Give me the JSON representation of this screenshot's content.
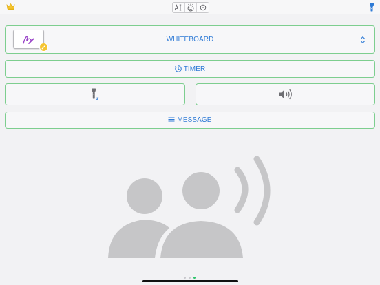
{
  "toolbar": {
    "left_icon": "crown-icon",
    "center_tools": [
      "text-cursor-icon",
      "face-icon",
      "zoom-out-icon"
    ],
    "right_icon": "torch-icon"
  },
  "controls": {
    "whiteboard": {
      "label": "WHITEBOARD",
      "thumbnail_icon": "pen-squiggle-icon",
      "badge_icon": "edit-icon"
    },
    "timer": {
      "label": "TIMER",
      "icon": "timer-icon"
    },
    "torch": {
      "icon": "flashlight-icon"
    },
    "sound": {
      "icon": "speaker-icon"
    },
    "message": {
      "label": "MESSAGE",
      "icon": "lines-icon"
    }
  },
  "hero": {
    "icon": "people-speaking-icon"
  },
  "pager": {
    "count": 3,
    "active": 3
  },
  "colors": {
    "accent_blue": "#2f7bd6",
    "border_green": "#7dce8f",
    "crown_yellow": "#f5c531",
    "pen_purple": "#9a45c8",
    "hero_gray": "#c6c6c8",
    "active_dot": "#2ec46b"
  }
}
